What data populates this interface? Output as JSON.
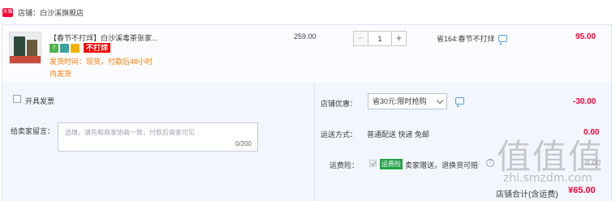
{
  "store": {
    "badge": "天猫",
    "label": "店铺：白沙溪旗舰店"
  },
  "item": {
    "title": "【春节不打烊】白沙溪毒茶张家...",
    "tag_icon_text": "7",
    "promo_tag": "不打烊",
    "ship_time": "发货时间：现货，付款后48小时",
    "ship_time_2": "内发货",
    "unit_price": "259.00",
    "quantity": "1",
    "minus_label": "−",
    "plus_label": "+",
    "promo_text": "省164:春节不打烊",
    "line_total": "95.00"
  },
  "options": {
    "invoice_label": "开具发票",
    "memo_label": "给卖家留言：",
    "memo_placeholder": "选填，请先和商家协商一致，付款后商家可见",
    "memo_count": "0/200",
    "store_discount_label": "店铺优惠：",
    "store_discount_value": "省30元:限时抢购",
    "store_discount_amount": "-30.00",
    "shipping_label": "运送方式：",
    "shipping_value": "普通配送 快递 免邮",
    "shipping_amount": "0.00",
    "insurance_label": "运费险：",
    "insurance_badge": "运费险",
    "insurance_text": "卖家赠送，退换货可赔",
    "insurance_help": "?",
    "insurance_amount": "0.00"
  },
  "footer": {
    "total_label": "店铺合计(含运费)",
    "total_amount": "¥65.00"
  },
  "watermark": {
    "glyphs": "值值值",
    "url": "zhi.smzdm.com"
  },
  "colors": {
    "accent": "#ff0036",
    "ship_orange": "#ff7a00",
    "panel_bg": "#f2f7ff"
  }
}
